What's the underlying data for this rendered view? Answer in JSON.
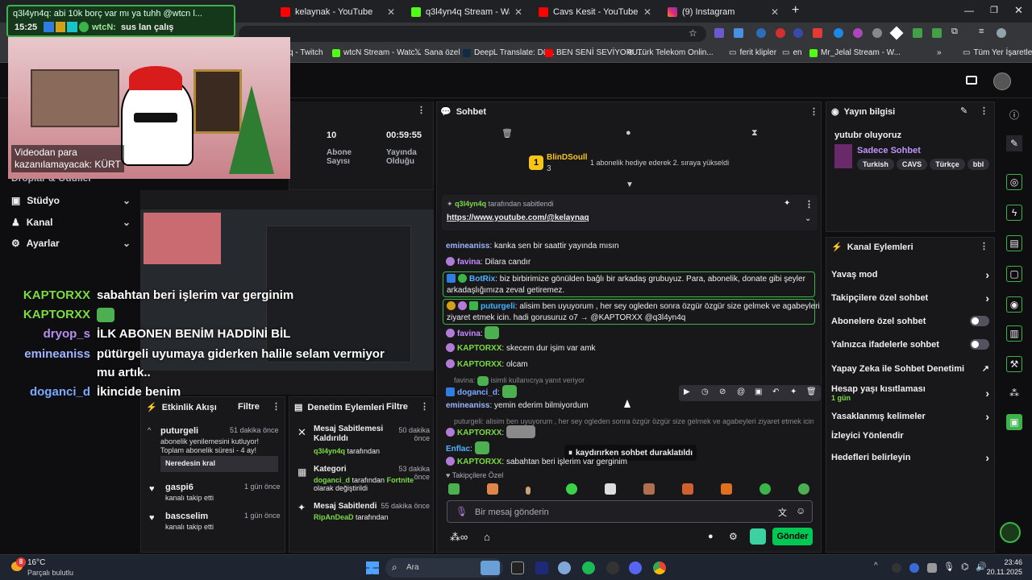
{
  "browser": {
    "tabs": [
      {
        "label": "kelaynak - YouTube"
      },
      {
        "label": "q3l4yn4q Stream - Watch Live o"
      },
      {
        "label": "Cavs Kesit - YouTube"
      },
      {
        "label": "(9) Instagram"
      }
    ],
    "new_tab": "+",
    "bookmarks": [
      "q - Twitch",
      "wtcN Stream - Watc...",
      "Sana özel",
      "DeepL Translate: Dü...",
      "BEN SENİ SEVİYORU...",
      "Türk Telekom Onlin...",
      "ferit klipler",
      "en",
      "Mr_Jelal Stream - W...",
      "Tüm Yer İşaretleri"
    ],
    "bookmarks_more": "»"
  },
  "notification": {
    "title": "q3l4yn4q: abi 10k borç var mı ya tuhh @wtcn l...",
    "time": "15:25",
    "sender": "wtcN:",
    "message": "sus lan çalış"
  },
  "webcam": {
    "caption": "Videodan para kazanılamayacak: KÜRT"
  },
  "stats": {
    "abone_value": "10",
    "abone_label": "Abone Sayısı",
    "time_value": "00:59:55",
    "time_label": "Yayında Olduğu"
  },
  "left_nav": {
    "partial": "Droplar & Ödüller",
    "items": [
      {
        "label": "Stüdyo"
      },
      {
        "label": "Kanal"
      },
      {
        "label": "Ayarlar"
      }
    ]
  },
  "overlay_chat": [
    {
      "name": "KAPTORXX",
      "msg": "sabahtan beri işlerim var gerginim",
      "color": "#7bdc3f"
    },
    {
      "name": "KAPTORXX",
      "msg": "",
      "color": "#7bdc3f"
    },
    {
      "name": "dryop_s",
      "msg": "İLK ABONEN BENİM HADDİNİ BİL",
      "color": "#b78ff0"
    },
    {
      "name": "emineaniss",
      "msg": "pütürgeli uyumaya giderken halile selam vermiyor",
      "color": "#9fb3ff"
    },
    {
      "name": "",
      "msg": "mu artık..",
      "color": "#fff"
    },
    {
      "name": "doganci_d",
      "msg": "İkincide benim",
      "color": "#7aa9ff"
    }
  ],
  "activity_feed": {
    "title": "Etkinlik Akışı",
    "filter": "Filtre",
    "items": [
      {
        "user": "puturgeli",
        "time": "51 dakika önce",
        "text": "abonelik yenilemesini kutluyor! Toplam abonelik süresi - 4 ay!",
        "reply": "Neredesin kral"
      },
      {
        "user": "gaspi6",
        "time": "1 gün önce",
        "text": "kanalı takip etti"
      },
      {
        "user": "bascselim",
        "time": "1 gün önce",
        "text": "kanalı takip etti"
      }
    ]
  },
  "mod_actions": {
    "title": "Denetim Eylemleri",
    "filter": "Filtre",
    "items": [
      {
        "title": "Mesaj Sabitlemesi Kaldırıldı",
        "time": "50 dakika önce",
        "by": "q3l4yn4q",
        "suffix": "tarafından"
      },
      {
        "title": "Kategori",
        "time": "53 dakika önce",
        "by": "doganci_d",
        "suffix": "tarafından",
        "extra": "Fortnite",
        "extra2": "olarak değiştirildi"
      },
      {
        "title": "Mesaj Sabitlendi",
        "time": "55 dakika önce",
        "by": "RipAnDeaD",
        "suffix": "tarafından"
      }
    ]
  },
  "chat": {
    "title": "Sohbet",
    "hype": {
      "user": "BlinDSoull",
      "count": "3",
      "rank": "1",
      "text": "1 abonelik hediye ederek 2. sıraya yükseldi"
    },
    "pinned": {
      "by": "q3l4yn4q",
      "by_suffix": "tarafından sabitlendi",
      "link": "https://www.youtube.com/@kelaynaq"
    },
    "messages": [
      {
        "user": "emineaniss",
        "text": ": kanka sen bir saattir yayında mısın",
        "color": "#9fb3ff"
      },
      {
        "user": "favina",
        "text": ": Dilara candır",
        "color": "#c58cff"
      },
      {
        "user": "BotRix",
        "text": ": biz birbirimize gönülden bağlı bir arkadaş grubuyuz. Para, abonelik, donate gibi şeyler",
        "text2": "arkadaşlığımıza zeval getiremez.",
        "color": "#4fb3ff"
      },
      {
        "user": "puturgeli",
        "text": ": alisim ben uyuyorum , her sey ogleden sonra özgür özgür size gelmek ve agabeyleri",
        "text2": "ziyaret etmek icin. hadi gorusuruz o7 → @KAPTORXX @q3l4yn4q",
        "color": "#3fb6ff"
      },
      {
        "user": "favina",
        "text": ":",
        "color": "#c58cff"
      },
      {
        "user": "KAPTORXX",
        "text": ": skecem dur işim var amk",
        "color": "#7bdc3f"
      },
      {
        "user": "KAPTORXX",
        "text": ": olcam",
        "color": "#7bdc3f"
      },
      {
        "user": "favina",
        "text": "isimli kullanıcıya yanıt veriyor",
        "color": "#888"
      },
      {
        "user": "doganci_d",
        "text": ":",
        "color": "#7aa9ff"
      },
      {
        "user": "emineaniss",
        "text": ": yemin ederim bilmiyordum",
        "color": "#9fb3ff"
      },
      {
        "user": "puturgeli",
        "text": ": alisim ben uyuyorum , her sey ogleden sonra özgür özgür size gelmek ve agabeyleri ziyaret etmek icin. ...",
        "color": "#888"
      },
      {
        "user": "KAPTORXX",
        "text": ":",
        "color": "#7bdc3f"
      },
      {
        "user": "Enflac",
        "text": ":",
        "color": "#4fb3ff"
      },
      {
        "user": "KAPTORXX",
        "text": ": sabahtan beri işlerim var gerginim",
        "color": "#7bdc3f"
      }
    ],
    "paused": "kaydırırken sohbet duraklatıldı",
    "followers_only": "Takipçilere Özel",
    "input_placeholder": "Bir mesaj gönderin",
    "send": "Gönder"
  },
  "stream_info": {
    "title": "Yayın bilgisi",
    "stream_title": "yutubr oluyoruz",
    "category": "Sadece Sohbet",
    "tags": [
      "Turkish",
      "CAVS",
      "Türkçe",
      "bbl"
    ]
  },
  "channel_actions": {
    "title": "Kanal Eylemleri",
    "items": [
      {
        "label": "Yavaş mod",
        "type": "arrow"
      },
      {
        "label": "Takipçilere özel sohbet",
        "type": "arrow"
      },
      {
        "label": "Abonelere özel sohbet",
        "type": "toggle"
      },
      {
        "label": "Yalnızca ifadelerle sohbet",
        "type": "toggle"
      },
      {
        "label": "Yapay Zeka ile Sohbet Denetimi",
        "type": "ext"
      },
      {
        "label": "Hesap yaşı kısıtlaması",
        "sub": "1 gün",
        "type": "arrow"
      },
      {
        "label": "Yasaklanmış kelimeler",
        "type": "arrow"
      },
      {
        "label": "İzleyici Yönlendir",
        "type": "none"
      },
      {
        "label": "Hedefleri belirleyin",
        "type": "arrow"
      }
    ]
  },
  "taskbar": {
    "temp": "16°C",
    "weather": "Parçalı bulutlu",
    "weather_badge": "8",
    "search": "Ara",
    "time": "23:46",
    "date": "20.11.2025"
  },
  "colors": {
    "accent": "#00c853",
    "twitch_purple": "#9146ff",
    "highlight_border": "#3bb54a"
  }
}
